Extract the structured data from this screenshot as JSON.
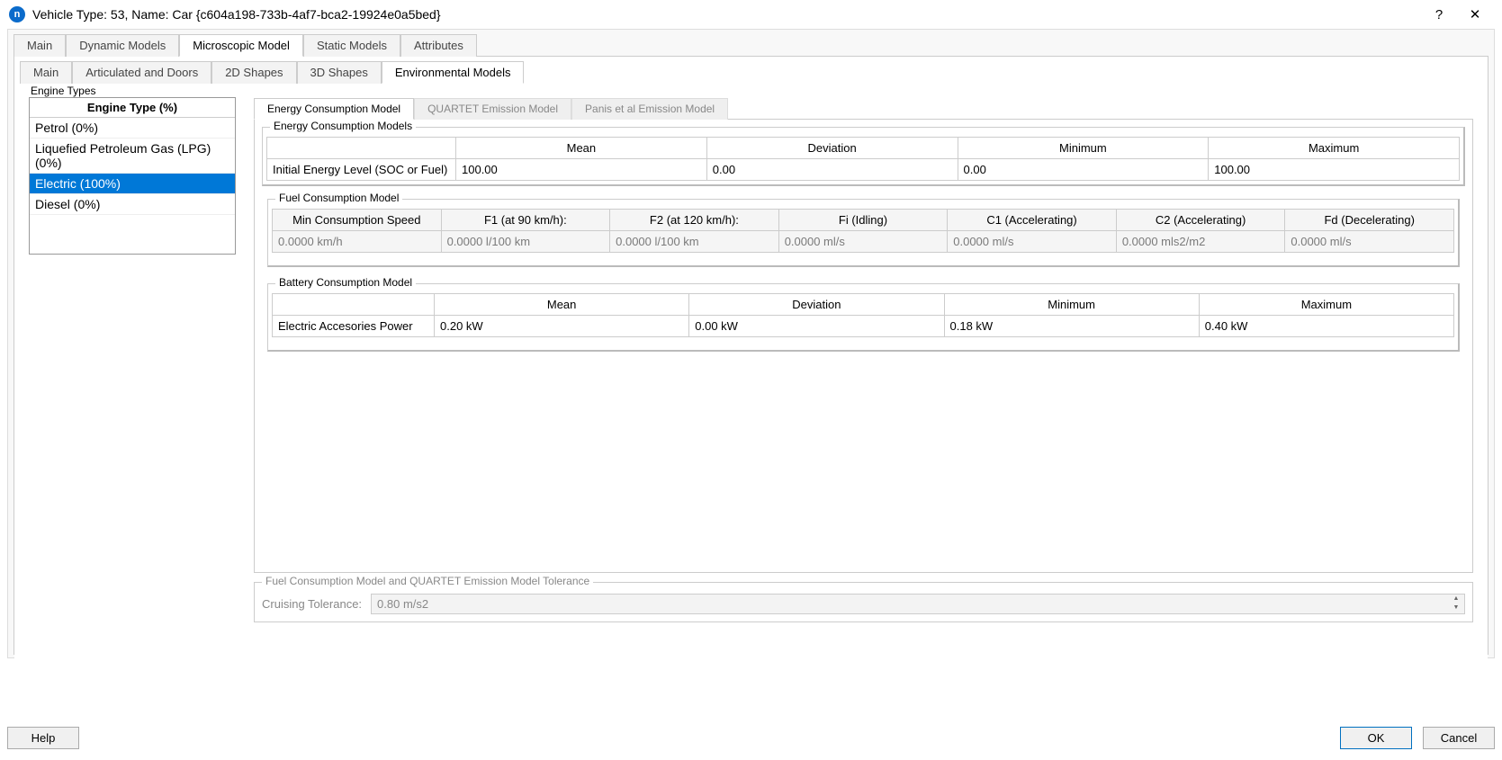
{
  "titlebar": {
    "icon_letter": "n",
    "title": "Vehicle Type: 53, Name: Car  {c604a198-733b-4af7-bca2-19924e0a5bed}",
    "help_glyph": "?",
    "close_glyph": "✕"
  },
  "outer_tabs": [
    {
      "label": "Main"
    },
    {
      "label": "Dynamic Models"
    },
    {
      "label": "Microscopic Model",
      "active": true
    },
    {
      "label": "Static Models"
    },
    {
      "label": "Attributes"
    }
  ],
  "inner_tabs": [
    {
      "label": "Main"
    },
    {
      "label": "Articulated and Doors"
    },
    {
      "label": "2D Shapes"
    },
    {
      "label": "3D Shapes"
    },
    {
      "label": "Environmental Models",
      "active": true
    }
  ],
  "engine_types": {
    "legend": "Engine Types",
    "header": "Engine Type (%)",
    "rows": [
      {
        "label": "Petrol (0%)"
      },
      {
        "label": "Liquefied Petroleum Gas (LPG) (0%)"
      },
      {
        "label": "Electric (100%)",
        "selected": true
      },
      {
        "label": "Diesel (0%)"
      }
    ]
  },
  "model_tabs": [
    {
      "label": "Energy Consumption Model",
      "active": true
    },
    {
      "label": "QUARTET Emission Model"
    },
    {
      "label": "Panis et al Emission Model"
    }
  ],
  "energy_models": {
    "legend": "Energy Consumption Models",
    "row_header": "Initial Energy Level (SOC or Fuel)",
    "cols": [
      "Mean",
      "Deviation",
      "Minimum",
      "Maximum"
    ],
    "vals": [
      "100.00",
      "0.00",
      "0.00",
      "100.00"
    ]
  },
  "fuel_model": {
    "legend": "Fuel Consumption Model",
    "headers": [
      "Min Consumption Speed",
      "F1 (at 90 km/h):",
      "F2 (at 120 km/h):",
      "Fi (Idling)",
      "C1 (Accelerating)",
      "C2 (Accelerating)",
      "Fd (Decelerating)"
    ],
    "vals": [
      "0.0000  km/h",
      "0.0000  l/100 km",
      "0.0000  l/100 km",
      "0.0000  ml/s",
      "0.0000  ml/s",
      "0.0000  mls2/m2",
      "0.0000  ml/s"
    ]
  },
  "battery_model": {
    "legend": "Battery Consumption Model",
    "row_header": "Electric Accesories Power",
    "cols": [
      "Mean",
      "Deviation",
      "Minimum",
      "Maximum"
    ],
    "vals": [
      "0.20 kW",
      "0.00 kW",
      "0.18 kW",
      "0.40 kW"
    ]
  },
  "tolerance": {
    "legend": "Fuel Consumption Model and QUARTET Emission Model Tolerance",
    "label": "Cruising Tolerance:",
    "value": "0.80 m/s2"
  },
  "buttons": {
    "help": "Help",
    "ok": "OK",
    "cancel": "Cancel"
  }
}
